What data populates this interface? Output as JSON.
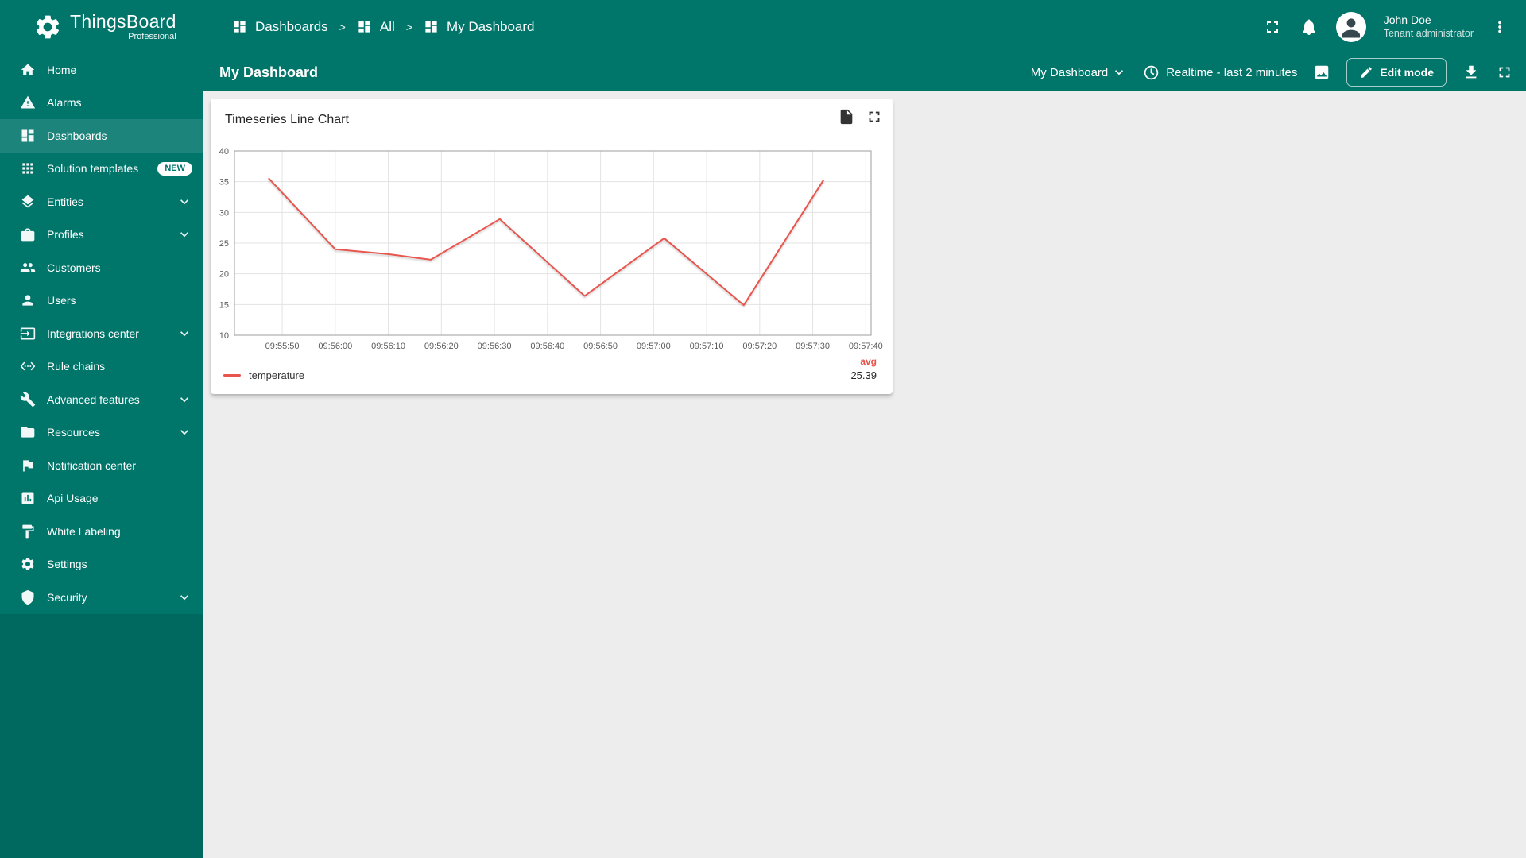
{
  "app": {
    "name": "ThingsBoard",
    "subtitle": "Professional"
  },
  "colors": {
    "primary": "#00756a",
    "content_bg": "#ededed",
    "line": "#e8554d",
    "badge_bg": "#ffffff"
  },
  "breadcrumb": {
    "separator": ">",
    "items": [
      {
        "label": "Dashboards",
        "icon": "dashboard-icon"
      },
      {
        "label": "All",
        "icon": "dashboard-icon"
      },
      {
        "label": "My Dashboard",
        "icon": "dashboard-icon"
      }
    ]
  },
  "user": {
    "name": "John Doe",
    "role": "Tenant administrator"
  },
  "sidebar": {
    "items": [
      {
        "label": "Home",
        "icon": "home-icon"
      },
      {
        "label": "Alarms",
        "icon": "alarms-icon"
      },
      {
        "label": "Dashboards",
        "icon": "dashboards-icon",
        "active": true
      },
      {
        "label": "Solution templates",
        "icon": "solution-templates-icon",
        "badge": "NEW"
      },
      {
        "label": "Entities",
        "icon": "entities-icon",
        "expandable": true
      },
      {
        "label": "Profiles",
        "icon": "profiles-icon",
        "expandable": true
      },
      {
        "label": "Customers",
        "icon": "customers-icon"
      },
      {
        "label": "Users",
        "icon": "users-icon"
      },
      {
        "label": "Integrations center",
        "icon": "integrations-center-icon",
        "expandable": true
      },
      {
        "label": "Rule chains",
        "icon": "rule-chains-icon"
      },
      {
        "label": "Advanced features",
        "icon": "advanced-features-icon",
        "expandable": true
      },
      {
        "label": "Resources",
        "icon": "resources-icon",
        "expandable": true
      },
      {
        "label": "Notification center",
        "icon": "notification-center-icon"
      },
      {
        "label": "Api Usage",
        "icon": "api-usage-icon"
      },
      {
        "label": "White Labeling",
        "icon": "white-labeling-icon"
      },
      {
        "label": "Settings",
        "icon": "settings-icon"
      },
      {
        "label": "Security",
        "icon": "security-icon",
        "expandable": true
      }
    ]
  },
  "toolbar": {
    "title": "My Dashboard",
    "dashboard_select": "My Dashboard",
    "time_window": "Realtime - last 2 minutes",
    "edit_button": "Edit mode"
  },
  "widget": {
    "title": "Timeseries Line Chart"
  },
  "chart_data": {
    "type": "line",
    "title": "Timeseries Line Chart",
    "grid": true,
    "legend_position": "bottom",
    "x_ticks": [
      "09:55:50",
      "09:56:00",
      "09:56:10",
      "09:56:20",
      "09:56:30",
      "09:56:40",
      "09:56:50",
      "09:57:00",
      "09:57:10",
      "09:57:20",
      "09:57:30",
      "09:57:40"
    ],
    "x_tick_seconds": [
      0,
      10,
      20,
      30,
      40,
      50,
      60,
      70,
      80,
      90,
      100,
      110
    ],
    "x_range_seconds": [
      -9,
      111
    ],
    "y_ticks": [
      10,
      15,
      20,
      25,
      30,
      35,
      40
    ],
    "y_range": [
      10,
      40
    ],
    "series": [
      {
        "name": "temperature",
        "color": "#e8554d",
        "points": [
          {
            "time": "09:55:47",
            "x_s": -2.5,
            "value": 35.5
          },
          {
            "time": "09:56:00",
            "x_s": 10,
            "value": 24.0
          },
          {
            "time": "09:56:10",
            "x_s": 20,
            "value": 23.2
          },
          {
            "time": "09:56:18",
            "x_s": 28,
            "value": 22.3
          },
          {
            "time": "09:56:31",
            "x_s": 41,
            "value": 28.9
          },
          {
            "time": "09:56:47",
            "x_s": 57,
            "value": 16.4
          },
          {
            "time": "09:57:02",
            "x_s": 72,
            "value": 25.8
          },
          {
            "time": "09:57:17",
            "x_s": 87,
            "value": 14.9
          },
          {
            "time": "09:57:32",
            "x_s": 102,
            "value": 35.2
          }
        ]
      }
    ],
    "legend": {
      "series_label": "temperature",
      "agg_label": "avg",
      "agg_value": "25.39"
    }
  }
}
